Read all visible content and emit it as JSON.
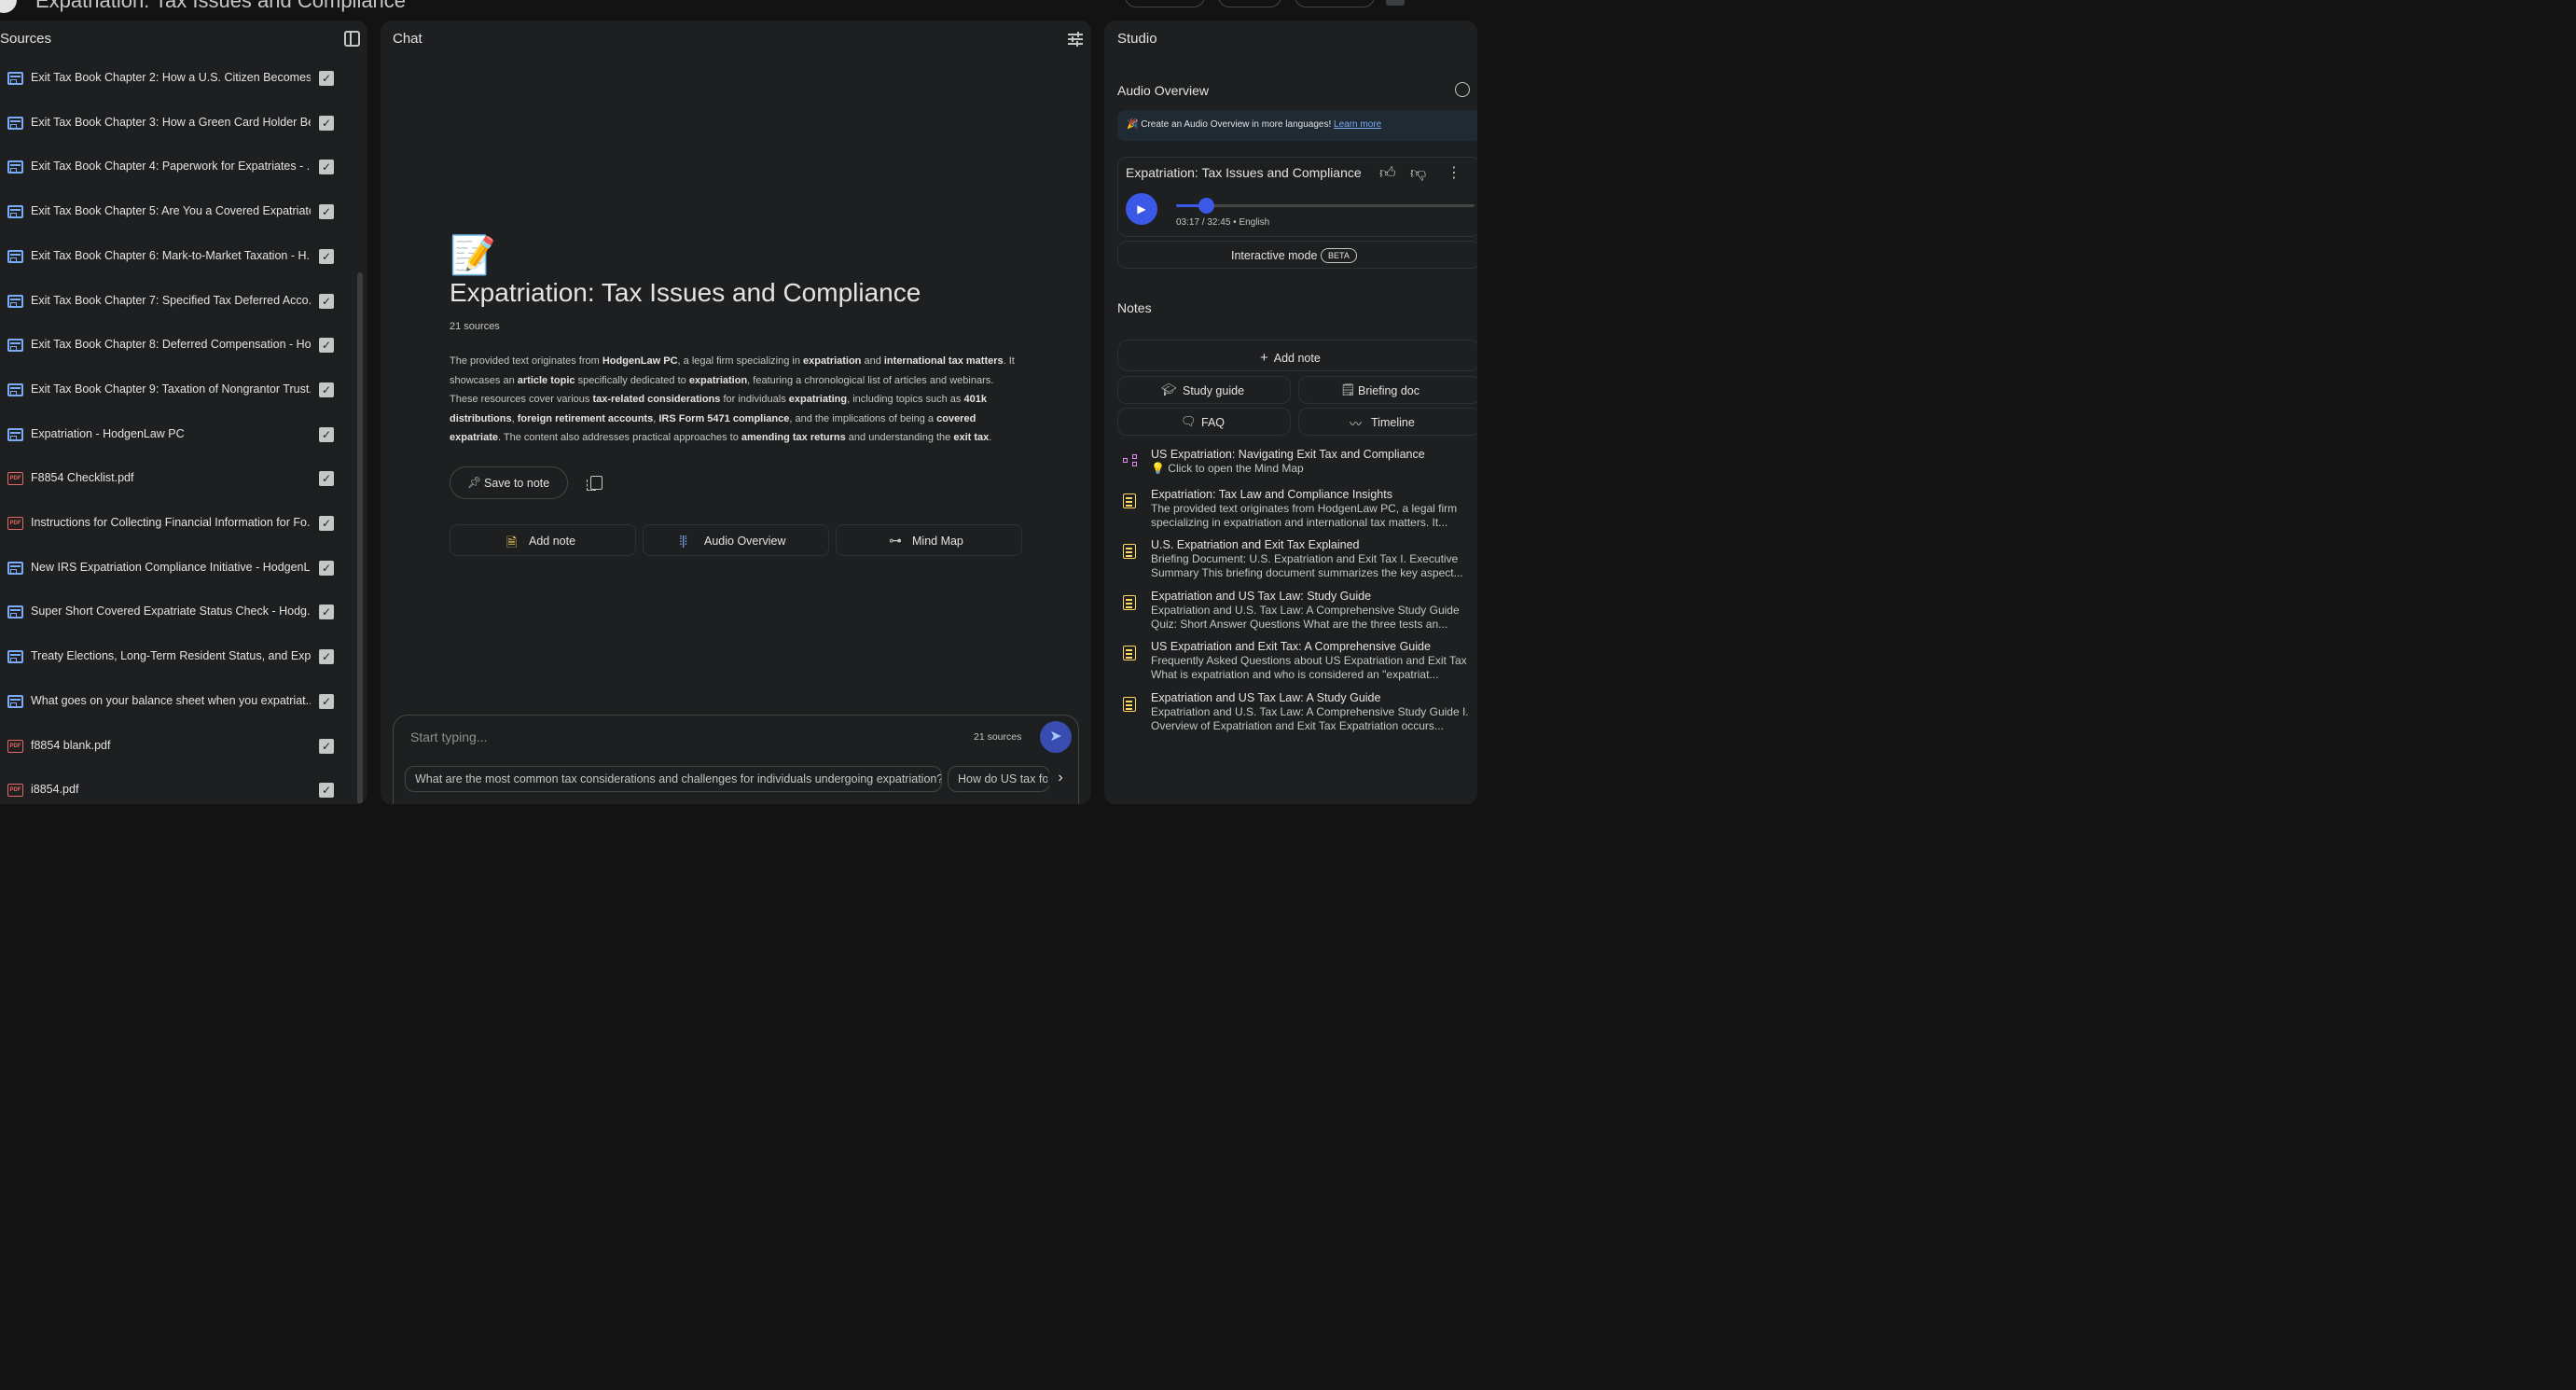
{
  "app": {
    "title": "Expatriation: Tax Issues and Compliance"
  },
  "sources": {
    "title": "Sources",
    "items": [
      {
        "label": "Exit Tax Book Chapter 2: How a U.S. Citizen Becomes ...",
        "icon": "web"
      },
      {
        "label": "Exit Tax Book Chapter 3: How a Green Card Holder Be...",
        "icon": "web"
      },
      {
        "label": "Exit Tax Book Chapter 4: Paperwork for Expatriates - ...",
        "icon": "web"
      },
      {
        "label": "Exit Tax Book Chapter 5: Are You a Covered Expatriate...",
        "icon": "web"
      },
      {
        "label": "Exit Tax Book Chapter 6: Mark-to-Market Taxation - H...",
        "icon": "web"
      },
      {
        "label": "Exit Tax Book Chapter 7: Specified Tax Deferred Acco...",
        "icon": "web"
      },
      {
        "label": "Exit Tax Book Chapter 8: Deferred Compensation - Ho...",
        "icon": "web"
      },
      {
        "label": "Exit Tax Book Chapter 9: Taxation of Nongrantor Trust...",
        "icon": "web"
      },
      {
        "label": "Expatriation - HodgenLaw PC",
        "icon": "web"
      },
      {
        "label": "F8854 Checklist.pdf",
        "icon": "pdf"
      },
      {
        "label": "Instructions for Collecting Financial Information for Fo...",
        "icon": "pdf"
      },
      {
        "label": "New IRS Expatriation Compliance Initiative - HodgenL...",
        "icon": "web"
      },
      {
        "label": "Super Short Covered Expatriate Status Check - Hodg...",
        "icon": "web"
      },
      {
        "label": "Treaty Elections, Long-Term Resident Status, and Exp...",
        "icon": "web"
      },
      {
        "label": "What goes on your balance sheet when you expatriat...",
        "icon": "web"
      },
      {
        "label": "f8854 blank.pdf",
        "icon": "pdf"
      },
      {
        "label": "i8854.pdf",
        "icon": "pdf"
      }
    ]
  },
  "chat": {
    "title": "Chat",
    "emoji": "📝",
    "notebook_title": "Expatriation: Tax Issues and Compliance",
    "source_count": "21 sources",
    "summary": [
      {
        "t": "The provided text originates from ",
        "b": false
      },
      {
        "t": "HodgenLaw PC",
        "b": true
      },
      {
        "t": ", a legal firm specializing in ",
        "b": false
      },
      {
        "t": "expatriation",
        "b": true
      },
      {
        "t": " and ",
        "b": false
      },
      {
        "t": "international tax matters",
        "b": true
      },
      {
        "t": ". It showcases an ",
        "b": false
      },
      {
        "t": "article topic",
        "b": true
      },
      {
        "t": " specifically dedicated to ",
        "b": false
      },
      {
        "t": "expatriation",
        "b": true
      },
      {
        "t": ", featuring a chronological list of articles and webinars. These resources cover various ",
        "b": false
      },
      {
        "t": "tax-related considerations",
        "b": true
      },
      {
        "t": " for individuals ",
        "b": false
      },
      {
        "t": "expatriating",
        "b": true
      },
      {
        "t": ", including topics such as ",
        "b": false
      },
      {
        "t": "401k distributions",
        "b": true
      },
      {
        "t": ", ",
        "b": false
      },
      {
        "t": "foreign retirement accounts",
        "b": true
      },
      {
        "t": ", ",
        "b": false
      },
      {
        "t": "IRS Form 5471 compliance",
        "b": true
      },
      {
        "t": ", and the implications of being a ",
        "b": false
      },
      {
        "t": "covered expatriate",
        "b": true
      },
      {
        "t": ". The content also addresses practical approaches to ",
        "b": false
      },
      {
        "t": "amending tax returns",
        "b": true
      },
      {
        "t": " and understanding the ",
        "b": false
      },
      {
        "t": "exit tax",
        "b": true
      },
      {
        "t": ".",
        "b": false
      }
    ],
    "save_to_note": "Save to note",
    "actions": {
      "add_note": "Add note",
      "audio_overview": "Audio Overview",
      "mind_map": "Mind Map"
    },
    "input": {
      "placeholder": "Start typing...",
      "source_count": "21 sources"
    },
    "suggestions": [
      "What are the most common tax considerations and challenges for individuals undergoing expatriation?",
      "How do US tax fo"
    ]
  },
  "studio": {
    "title": "Studio",
    "audio_overview": {
      "title": "Audio Overview",
      "banner_text": "🎉 Create an Audio Overview in more languages!",
      "banner_link": "Learn more",
      "card_title": "Expatriation: Tax Issues and Compliance",
      "time": "03:17 / 32:45 • English",
      "progress_fraction": 0.1005,
      "interactive_label": "Interactive mode",
      "beta": "BETA"
    },
    "notes": {
      "title": "Notes",
      "add_note": "Add note",
      "buttons": [
        "Study guide",
        "Briefing doc",
        "FAQ",
        "Timeline"
      ],
      "items": [
        {
          "type": "mindmap",
          "title": "US Expatriation: Navigating Exit Tax and Compliance",
          "subtitle": "💡 Click to open the Mind Map"
        },
        {
          "type": "note",
          "title": "Expatriation: Tax Law and Compliance Insights",
          "subtitle": "The provided text originates from HodgenLaw PC, a legal firm specializing in expatriation and international tax matters. It..."
        },
        {
          "type": "note",
          "title": "U.S. Expatriation and Exit Tax Explained",
          "subtitle": "Briefing Document: U.S. Expatriation and Exit Tax I. Executive Summary This briefing document summarizes the key aspect..."
        },
        {
          "type": "note",
          "title": "Expatriation and US Tax Law: Study Guide",
          "subtitle": "Expatriation and U.S. Tax Law: A Comprehensive Study Guide Quiz: Short Answer Questions What are the three tests an..."
        },
        {
          "type": "note",
          "title": "US Expatriation and Exit Tax: A Comprehensive Guide",
          "subtitle": "Frequently Asked Questions about US Expatriation and Exit Tax What is expatriation and who is considered an \"expatriat..."
        },
        {
          "type": "note",
          "title": "Expatriation and US Tax Law: A Study Guide",
          "subtitle": "Expatriation and U.S. Tax Law: A Comprehensive Study Guide I. Overview of Expatriation and Exit Tax Expatriation occurs..."
        }
      ]
    }
  }
}
